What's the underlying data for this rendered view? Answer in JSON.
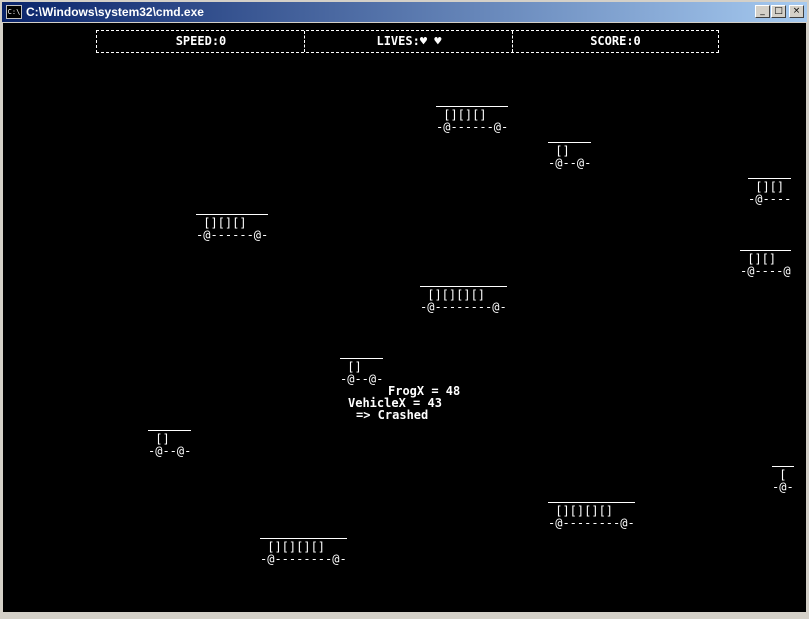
{
  "window": {
    "title": "C:\\Windows\\system32\\cmd.exe",
    "icon": "C:\\",
    "buttons": {
      "minimize": "_",
      "maximize": "□",
      "close": "×"
    }
  },
  "hud": {
    "speed": "SPEED:0",
    "lives": "LIVES:♥ ♥",
    "score": "SCORE:0"
  },
  "vehicles": [
    {
      "roof": " [][][] ",
      "wheels": "-@------@-"
    },
    {
      "roof": " [] ",
      "wheels": "-@--@-"
    },
    {
      "roof": " [][]",
      "wheels": "-@----"
    },
    {
      "roof": " [][][] ",
      "wheels": "-@------@-"
    },
    {
      "roof": " [][]",
      "wheels": "-@----@"
    },
    {
      "roof": " [][][][] ",
      "wheels": "-@--------@-"
    },
    {
      "roof": " [] ",
      "wheels": "-@--@-"
    },
    {
      "roof": " [] ",
      "wheels": "-@--@-"
    },
    {
      "roof": " [",
      "wheels": "-@-"
    },
    {
      "roof": " [][][][] ",
      "wheels": "-@--------@-"
    },
    {
      "roof": " [][][][] ",
      "wheels": "-@--------@-"
    }
  ],
  "status": {
    "line1": "FrogX = 48",
    "line2": "VehicleX = 43",
    "line3": "=> Crashed"
  },
  "colors": {
    "background": "#000000",
    "text": "#ffffff",
    "titlebar": "#0a246a"
  }
}
